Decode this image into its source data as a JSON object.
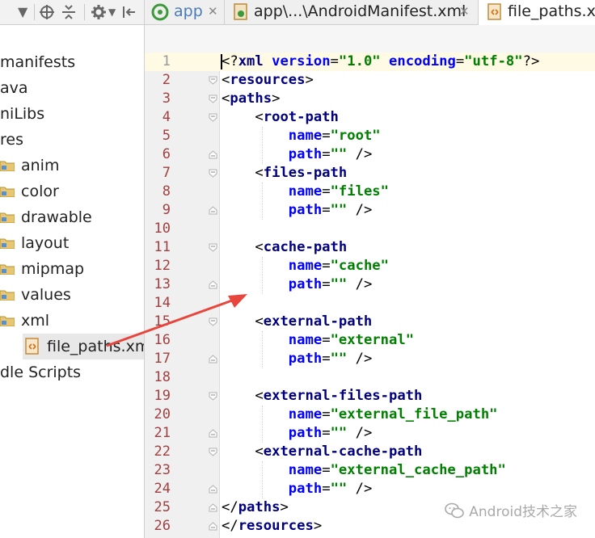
{
  "tree": {
    "items": [
      {
        "label": "manifests",
        "indent": 0
      },
      {
        "label": "ava",
        "indent": 0
      },
      {
        "label": "niLibs",
        "indent": 0
      },
      {
        "label": "res",
        "indent": 0
      },
      {
        "label": "anim",
        "indent": 1
      },
      {
        "label": "color",
        "indent": 1
      },
      {
        "label": "drawable",
        "indent": 1
      },
      {
        "label": "layout",
        "indent": 1
      },
      {
        "label": "mipmap",
        "indent": 1
      },
      {
        "label": "values",
        "indent": 1
      },
      {
        "label": "xml",
        "indent": 1
      },
      {
        "label": "file_paths.xml",
        "indent": 2,
        "selected": true
      },
      {
        "label": "dle Scripts",
        "indent": 0
      }
    ]
  },
  "tabs": [
    {
      "label": "app",
      "icon": "android-app-icon",
      "active": false
    },
    {
      "label": "app\\...\\AndroidManifest.xml",
      "icon": "manifest-file-icon",
      "active": false
    },
    {
      "label": "file_paths.xm",
      "icon": "xml-file-icon",
      "active": true
    }
  ],
  "editor": {
    "line_numbers": [
      "1",
      "2",
      "3",
      "4",
      "5",
      "6",
      "7",
      "8",
      "9",
      "10",
      "11",
      "12",
      "13",
      "14",
      "15",
      "16",
      "17",
      "18",
      "19",
      "20",
      "21",
      "22",
      "23",
      "24",
      "25",
      "26"
    ],
    "lines": [
      [
        [
          "pl",
          "<?"
        ],
        [
          "tag",
          "xml"
        ],
        [
          "pl",
          " "
        ],
        [
          "attr",
          "version"
        ],
        [
          "pl",
          "="
        ],
        [
          "val",
          "\"1.0\""
        ],
        [
          "pl",
          " "
        ],
        [
          "attr",
          "encoding"
        ],
        [
          "pl",
          "="
        ],
        [
          "val",
          "\"utf-8\""
        ],
        [
          "pl",
          "?>"
        ]
      ],
      [
        [
          "pl",
          "<"
        ],
        [
          "tag",
          "resources"
        ],
        [
          "pl",
          ">"
        ]
      ],
      [
        [
          "pl",
          "<"
        ],
        [
          "tag",
          "paths"
        ],
        [
          "pl",
          ">"
        ]
      ],
      [
        [
          "pl",
          "    <"
        ],
        [
          "tag",
          "root-path"
        ]
      ],
      [
        [
          "pl",
          "        "
        ],
        [
          "attr",
          "name"
        ],
        [
          "pl",
          "="
        ],
        [
          "val",
          "\"root\""
        ]
      ],
      [
        [
          "pl",
          "        "
        ],
        [
          "attr",
          "path"
        ],
        [
          "pl",
          "="
        ],
        [
          "val",
          "\"\""
        ],
        [
          "pl",
          " />"
        ]
      ],
      [
        [
          "pl",
          "    <"
        ],
        [
          "tag",
          "files-path"
        ]
      ],
      [
        [
          "pl",
          "        "
        ],
        [
          "attr",
          "name"
        ],
        [
          "pl",
          "="
        ],
        [
          "val",
          "\"files\""
        ]
      ],
      [
        [
          "pl",
          "        "
        ],
        [
          "attr",
          "path"
        ],
        [
          "pl",
          "="
        ],
        [
          "val",
          "\"\""
        ],
        [
          "pl",
          " />"
        ]
      ],
      [],
      [
        [
          "pl",
          "    <"
        ],
        [
          "tag",
          "cache-path"
        ]
      ],
      [
        [
          "pl",
          "        "
        ],
        [
          "attr",
          "name"
        ],
        [
          "pl",
          "="
        ],
        [
          "val",
          "\"cache\""
        ]
      ],
      [
        [
          "pl",
          "        "
        ],
        [
          "attr",
          "path"
        ],
        [
          "pl",
          "="
        ],
        [
          "val",
          "\"\""
        ],
        [
          "pl",
          " />"
        ]
      ],
      [],
      [
        [
          "pl",
          "    <"
        ],
        [
          "tag",
          "external-path"
        ]
      ],
      [
        [
          "pl",
          "        "
        ],
        [
          "attr",
          "name"
        ],
        [
          "pl",
          "="
        ],
        [
          "val",
          "\"external\""
        ]
      ],
      [
        [
          "pl",
          "        "
        ],
        [
          "attr",
          "path"
        ],
        [
          "pl",
          "="
        ],
        [
          "val",
          "\"\""
        ],
        [
          "pl",
          " />"
        ]
      ],
      [],
      [
        [
          "pl",
          "    <"
        ],
        [
          "tag",
          "external-files-path"
        ]
      ],
      [
        [
          "pl",
          "        "
        ],
        [
          "attr",
          "name"
        ],
        [
          "pl",
          "="
        ],
        [
          "val",
          "\"external_file_path\""
        ]
      ],
      [
        [
          "pl",
          "        "
        ],
        [
          "attr",
          "path"
        ],
        [
          "pl",
          "="
        ],
        [
          "val",
          "\"\""
        ],
        [
          "pl",
          " />"
        ]
      ],
      [
        [
          "pl",
          "    <"
        ],
        [
          "tag",
          "external-cache-path"
        ]
      ],
      [
        [
          "pl",
          "        "
        ],
        [
          "attr",
          "name"
        ],
        [
          "pl",
          "="
        ],
        [
          "val",
          "\"external_cache_path\""
        ]
      ],
      [
        [
          "pl",
          "        "
        ],
        [
          "attr",
          "path"
        ],
        [
          "pl",
          "="
        ],
        [
          "val",
          "\"\""
        ],
        [
          "pl",
          " />"
        ]
      ],
      [
        [
          "pl",
          "</"
        ],
        [
          "tag",
          "paths"
        ],
        [
          "pl",
          ">"
        ]
      ],
      [
        [
          "pl",
          "</"
        ],
        [
          "tag",
          "resources"
        ],
        [
          "pl",
          ">"
        ]
      ]
    ],
    "fold_open_lines": [
      2,
      3,
      4,
      7,
      11,
      15,
      19,
      22
    ],
    "fold_close_lines": [
      6,
      9,
      13,
      17,
      21,
      24,
      25,
      26
    ]
  },
  "watermark": {
    "text": "Android技术之家",
    "icon": "wechat-icon"
  },
  "colors": {
    "tag": "#000080",
    "attr": "#0000ff",
    "value": "#008000",
    "arrow": "#e8453c",
    "current_line": "#fffae3"
  }
}
